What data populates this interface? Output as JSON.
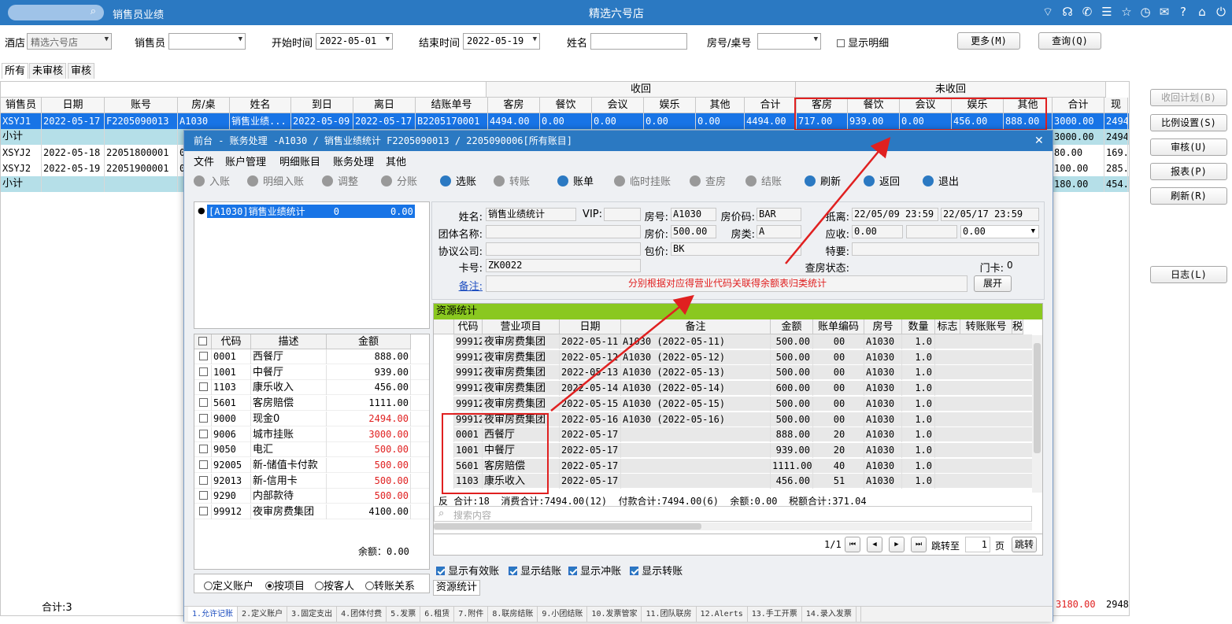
{
  "app": {
    "title": "销售员业绩",
    "store": "精选六号店",
    "search_icon": "⌕",
    "top_icons": [
      "wifi-icon",
      "headset-icon",
      "phone-icon",
      "menu-icon",
      "star-icon",
      "clock-icon",
      "mail-icon",
      "help-icon",
      "home-icon",
      "power-icon"
    ]
  },
  "filters": {
    "hotel_label": "酒店",
    "hotel_value": "精选六号店",
    "salesman_label": "销售员",
    "salesman_value": "",
    "start_label": "开始时间",
    "start_value": "2022-05-01",
    "end_label": "结束时间",
    "end_value": "2022-05-19",
    "name_label": "姓名",
    "name_value": "",
    "room_label": "房号/桌号",
    "room_value": "",
    "detail_label": "显示明细",
    "more_btn": "更多(M)",
    "query_btn": "查询(Q)"
  },
  "tabs": [
    "所有",
    "未审核",
    "审核"
  ],
  "grid": {
    "group_recovered": "收回",
    "group_unrecovered": "未收回",
    "headers": [
      "销售员",
      "日期",
      "账号",
      "房/桌",
      "姓名",
      "到日",
      "离日",
      "结账单号",
      "客房",
      "餐饮",
      "会议",
      "娱乐",
      "其他",
      "合计",
      "客房",
      "餐饮",
      "会议",
      "娱乐",
      "其他",
      "合计",
      "现"
    ],
    "rows": [
      {
        "type": "sel",
        "cells": [
          "XSYJ1",
          "2022-05-17",
          "F2205090013",
          "A1030",
          "销售业绩...",
          "2022-05-09",
          "2022-05-17",
          "B2205170001",
          "4494.00",
          "0.00",
          "0.00",
          "0.00",
          "0.00",
          "4494.00",
          "717.00",
          "939.00",
          "0.00",
          "456.00",
          "888.00",
          "3000.00",
          "2494."
        ]
      },
      {
        "type": "sub",
        "cells": [
          "小计",
          "",
          "",
          "",
          "",
          "",
          "",
          "",
          "",
          "",
          "",
          "",
          "",
          "",
          "",
          "",
          "",
          "",
          "",
          "3000.00",
          "2494."
        ]
      },
      {
        "type": "normal",
        "cells": [
          "XSYJ2",
          "2022-05-18",
          "22051800001",
          "00",
          "",
          "",
          "",
          "",
          "",
          "",
          "",
          "",
          "",
          "",
          "",
          "",
          "",
          "",
          "",
          "80.00",
          "169."
        ]
      },
      {
        "type": "normal",
        "cells": [
          "XSYJ2",
          "2022-05-19",
          "22051900001",
          "00",
          "",
          "",
          "",
          "",
          "",
          "",
          "",
          "",
          "",
          "",
          "",
          "",
          "",
          "",
          "",
          "100.00",
          "285."
        ]
      },
      {
        "type": "sub",
        "cells": [
          "小计",
          "",
          "",
          "",
          "",
          "",
          "",
          "",
          "",
          "",
          "",
          "",
          "",
          "",
          "",
          "",
          "",
          "",
          "",
          "180.00",
          "454."
        ]
      }
    ],
    "total_label": "合计:3",
    "total_sum": "3180.00",
    "total_cash": "2948."
  },
  "right_buttons": [
    {
      "label": "收回计划(B)",
      "disabled": true
    },
    {
      "label": "比例设置(S)",
      "disabled": false
    },
    {
      "label": "审核(U)",
      "disabled": false
    },
    {
      "label": "报表(P)",
      "disabled": false
    },
    {
      "label": "刷新(R)",
      "disabled": false
    },
    {
      "label": "日志(L)",
      "disabled": false
    }
  ],
  "dialog": {
    "title": "前台 - 账务处理 -A1030  /  销售业绩统计  F2205090013  /  2205090006[所有账目]",
    "close": "✕",
    "menu": [
      "文件",
      "账户管理",
      "明细账目",
      "账务处理",
      "其他"
    ],
    "toolbar": [
      {
        "label": "入账",
        "state": "off"
      },
      {
        "label": "明细入账",
        "state": "off"
      },
      {
        "label": "调整",
        "state": "off"
      },
      {
        "label": "分账",
        "state": "off"
      },
      {
        "label": "选账",
        "state": "on"
      },
      {
        "label": "转账",
        "state": "off"
      },
      {
        "label": "账单",
        "state": "on"
      },
      {
        "label": "临时挂账",
        "state": "off"
      },
      {
        "label": "查房",
        "state": "off"
      },
      {
        "label": "结账",
        "state": "off"
      },
      {
        "label": "刷新",
        "state": "on"
      },
      {
        "label": "返回",
        "state": "on"
      },
      {
        "label": "退出",
        "state": "on"
      }
    ],
    "tree_item": "[A1030]销售业绩统计     0         0.00",
    "guest": {
      "name_label": "姓名:",
      "name": "销售业绩统计",
      "vip_label": "VIP:",
      "vip": "",
      "room_label": "房号:",
      "room": "A1030",
      "rate_code_label": "房价码:",
      "rate_code": "BAR",
      "arrive_label": "抵离:",
      "arrive": "22/05/09 23:59",
      "depart": "22/05/17 23:59",
      "group_label": "团体名称:",
      "group": "",
      "price_label": "房价:",
      "price": "500.00",
      "type_label": "房类:",
      "type": "A",
      "due_label": "应收:",
      "due": "0.00",
      "due2": "",
      "due3": "0.00",
      "agreement_label": "协议公司:",
      "agreement": "",
      "package_label": "包价:",
      "package": "BK",
      "special_label": "特要:",
      "special": "",
      "card_label": "卡号:",
      "card": "ZK0022",
      "check_label": "查房状态:",
      "check": "",
      "doorcard_label": "门卡:",
      "doorcard": "0",
      "note_label": "备注:",
      "annotation": "分别根据对应得营业代码关联得余额表归类统计",
      "expand_btn": "展开"
    },
    "left_table": {
      "headers": [
        "代码",
        "描述",
        "金额"
      ],
      "rows": [
        {
          "code": "0001",
          "desc": "西餐厅",
          "amt": "888.00",
          "red": false
        },
        {
          "code": "1001",
          "desc": "中餐厅",
          "amt": "939.00",
          "red": false
        },
        {
          "code": "1103",
          "desc": "康乐收入",
          "amt": "456.00",
          "red": false
        },
        {
          "code": "5601",
          "desc": "客房赔偿",
          "amt": "1111.00",
          "red": false
        },
        {
          "code": "9000",
          "desc": "现金0",
          "amt": "2494.00",
          "red": true
        },
        {
          "code": "9006",
          "desc": "城市挂账",
          "amt": "3000.00",
          "red": true
        },
        {
          "code": "9050",
          "desc": "电汇",
          "amt": "500.00",
          "red": true
        },
        {
          "code": "92005",
          "desc": "新-储值卡付款",
          "amt": "500.00",
          "red": true
        },
        {
          "code": "92013",
          "desc": "新-信用卡",
          "amt": "500.00",
          "red": true
        },
        {
          "code": "9290",
          "desc": "内部款待",
          "amt": "500.00",
          "red": true
        },
        {
          "code": "99912",
          "desc": "夜审房费集团",
          "amt": "4100.00",
          "red": false
        }
      ],
      "balance": "余额：0.00",
      "radios": [
        "定义账户",
        "按项目",
        "按客人",
        "转账关系"
      ],
      "radio_selected": 1
    },
    "resource": {
      "title": "资源统计",
      "headers": [
        "代码",
        "营业项目",
        "日期",
        "备注",
        "金额",
        "账单编码",
        "房号",
        "数量",
        "标志",
        "转账账号",
        "税"
      ],
      "rows": [
        [
          "99912",
          "夜审房费集团",
          "2022-05-11",
          "A1030 (2022-05-11)",
          "500.00",
          "00",
          "A1030",
          "1.0"
        ],
        [
          "99912",
          "夜审房费集团",
          "2022-05-12",
          "A1030 (2022-05-12)",
          "500.00",
          "00",
          "A1030",
          "1.0"
        ],
        [
          "99912",
          "夜审房费集团",
          "2022-05-13",
          "A1030 (2022-05-13)",
          "500.00",
          "00",
          "A1030",
          "1.0"
        ],
        [
          "99912",
          "夜审房费集团",
          "2022-05-14",
          "A1030 (2022-05-14)",
          "600.00",
          "00",
          "A1030",
          "1.0"
        ],
        [
          "99912",
          "夜审房费集团",
          "2022-05-15",
          "A1030 (2022-05-15)",
          "500.00",
          "00",
          "A1030",
          "1.0"
        ],
        [
          "99912",
          "夜审房费集团",
          "2022-05-16",
          "A1030 (2022-05-16)",
          "500.00",
          "00",
          "A1030",
          "1.0"
        ],
        [
          "0001",
          "西餐厅",
          "2022-05-17",
          "",
          "888.00",
          "20",
          "A1030",
          "1.0"
        ],
        [
          "1001",
          "中餐厅",
          "2022-05-17",
          "",
          "939.00",
          "20",
          "A1030",
          "1.0"
        ],
        [
          "5601",
          "客房赔偿",
          "2022-05-17",
          "",
          "1111.00",
          "40",
          "A1030",
          "1.0"
        ],
        [
          "1103",
          "康乐收入",
          "2022-05-17",
          "",
          "456.00",
          "51",
          "A1030",
          "1.0"
        ]
      ],
      "summary": "反 合计:18  消费合计:7494.00(12)  付款合计:7494.00(6)  余额:0.00  税额合计:371.04",
      "search_placeholder": "搜索内容",
      "page_info": "1/1",
      "jump_label": "跳转至",
      "page_value": "1",
      "page_unit": "页",
      "jump_btn": "跳转",
      "checks": [
        "显示有效账",
        "显示结账",
        "显示冲账",
        "显示转账"
      ],
      "bottom_tab": "资源统计"
    },
    "bottom_tabs": [
      "1.允许记账",
      "2.定义账户",
      "3.固定支出",
      "4.团体付费",
      "5.发票",
      "6.租赁",
      "7.附件",
      "8.联房结账",
      "9.小团结账",
      "10.发票管家",
      "11.团队联房",
      "12.Alerts",
      "13.手工开票",
      "14.录入发票"
    ]
  },
  "colors": {
    "accent": "#2b79c2",
    "selected_row": "#1874e6",
    "subtotal_row": "#b5dfe8",
    "highlight_red": "#e02020",
    "resource_header": "#8ac820"
  }
}
